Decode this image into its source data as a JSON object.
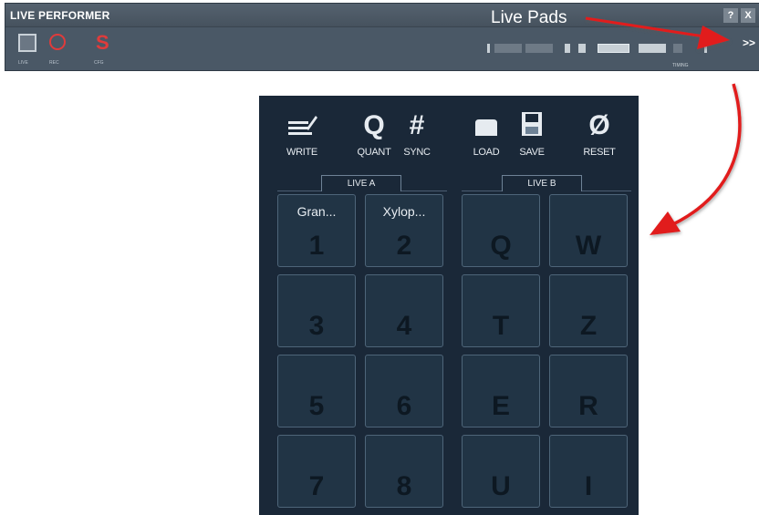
{
  "performer": {
    "title": "LIVE PERFORMER",
    "help_label": "?",
    "close_label": "X",
    "expand_label": ">>",
    "modes": [
      {
        "label": "LIVE",
        "icon": "live-mode-icon"
      },
      {
        "label": "REC",
        "icon": "record-icon"
      },
      {
        "label": "CFG",
        "icon": "config-icon"
      }
    ],
    "timing_label": "TIMING"
  },
  "callout": {
    "text": "Live Pads",
    "color": "#e11c1c"
  },
  "panel": {
    "tools": [
      {
        "label": "WRITE",
        "icon": "write-icon",
        "glyph": "≡"
      },
      {
        "label": "QUANT",
        "icon": "quantize-icon",
        "glyph": "Q"
      },
      {
        "label": "SYNC",
        "icon": "sync-icon",
        "glyph": "#"
      },
      {
        "label": "LOAD",
        "icon": "load-icon",
        "glyph": ""
      },
      {
        "label": "SAVE",
        "icon": "save-icon",
        "glyph": ""
      },
      {
        "label": "RESET",
        "icon": "reset-icon",
        "glyph": "Ø"
      }
    ],
    "live_a": {
      "label": "LIVE A",
      "pads": [
        {
          "name": "Gran...",
          "key": "1"
        },
        {
          "name": "Xylop...",
          "key": "2"
        },
        {
          "name": "",
          "key": "3"
        },
        {
          "name": "",
          "key": "4"
        },
        {
          "name": "",
          "key": "5"
        },
        {
          "name": "",
          "key": "6"
        },
        {
          "name": "",
          "key": "7"
        },
        {
          "name": "",
          "key": "8"
        }
      ]
    },
    "live_b": {
      "label": "LIVE B",
      "pads": [
        {
          "name": "",
          "key": "Q"
        },
        {
          "name": "",
          "key": "W"
        },
        {
          "name": "",
          "key": "T"
        },
        {
          "name": "",
          "key": "Z"
        },
        {
          "name": "",
          "key": "E"
        },
        {
          "name": "",
          "key": "R"
        },
        {
          "name": "",
          "key": "U"
        },
        {
          "name": "",
          "key": "I"
        }
      ]
    }
  },
  "colors": {
    "panel_bg": "#1a2838",
    "pad_bg": "#213445",
    "bar_bg": "#4a5866",
    "accent_red": "#e03b3b"
  }
}
